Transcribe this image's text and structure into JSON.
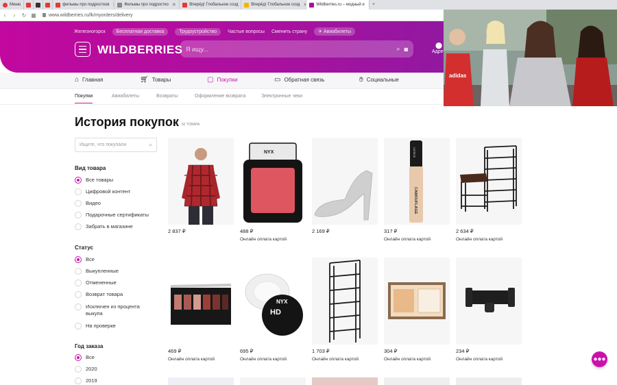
{
  "browser": {
    "menu_label": "Меню",
    "tabs": [
      {
        "label": "фильмы про подростков",
        "color": "#e53935"
      },
      {
        "label": "Фильмы про подростко",
        "color": "#888888"
      },
      {
        "label": "Вперёд! Глобальное созд",
        "color": "#e53935"
      },
      {
        "label": "Вперёд! Глобальное созд",
        "color": "#f4b400"
      },
      {
        "label": "Wildberries.ru – модный и",
        "color": "#a8119f",
        "active": true
      }
    ],
    "new_tab": "+",
    "url": "www.wildberries.ru/lk/myorders/delivery"
  },
  "header": {
    "links": [
      "Железногорск",
      "Бесплатная доставка",
      "Трудоустройство",
      "Частые вопросы",
      "Сменить страну",
      "Авиабилеты"
    ],
    "logo": "WILDBERRIES",
    "search_placeholder": "Я ищу...",
    "address_label": "Адрес"
  },
  "mainnav": [
    {
      "label": "Главная",
      "icon": "home-icon"
    },
    {
      "label": "Товары",
      "icon": "cart-icon"
    },
    {
      "label": "Покупки",
      "icon": "bag-icon",
      "active": true
    },
    {
      "label": "Обратная связь",
      "icon": "chat-icon"
    },
    {
      "label": "Социальные",
      "icon": "like-icon"
    }
  ],
  "subnav": [
    "Покупки",
    "Авиабилеты",
    "Возвраты",
    "Оформление возврата",
    "Электронные чеки"
  ],
  "page": {
    "title": "История покупок",
    "count": "92 товара"
  },
  "filters": {
    "search_placeholder": "Ищите, что покупали",
    "groups": [
      {
        "title": "Вид товара",
        "options": [
          "Все товары",
          "Цифровой контент",
          "Видео",
          "Подарочные сертификаты",
          "Забрать в магазине"
        ],
        "selected": 0
      },
      {
        "title": "Статус",
        "options": [
          "Все",
          "Выкупленные",
          "Отмененные",
          "Возврат товара",
          "Исключен из процента выкупа",
          "На проверке"
        ],
        "selected": 0
      },
      {
        "title": "Год заказа",
        "options": [
          "Все",
          "2020",
          "2019"
        ],
        "selected": 0
      }
    ]
  },
  "products": [
    {
      "price": "2 837 ₽",
      "pay": "",
      "kind": "shirt"
    },
    {
      "price": "488 ₽",
      "pay": "Онлайн оплата картой",
      "kind": "blush"
    },
    {
      "price": "2 169 ₽",
      "pay": "",
      "kind": "shoe"
    },
    {
      "price": "317 ₽",
      "pay": "Онлайн оплата картой",
      "kind": "concealer"
    },
    {
      "price": "2 634 ₽",
      "pay": "Онлайн оплата картой",
      "kind": "rack-bench"
    },
    {
      "price": "469 ₽",
      "pay": "Онлайн оплата картой",
      "kind": "palette"
    },
    {
      "price": "695 ₽",
      "pay": "Онлайн оплата картой",
      "kind": "powder"
    },
    {
      "price": "1 703 ₽",
      "pay": "Онлайн оплата картой",
      "kind": "rack"
    },
    {
      "price": "304 ₽",
      "pay": "Онлайн оплата картой",
      "kind": "box"
    },
    {
      "price": "234 ₽",
      "pay": "Онлайн оплата картой",
      "kind": "holder"
    }
  ],
  "product_text": {
    "blush_brand": "NYX",
    "concealer_brand": "CATRICE",
    "concealer_name": "CAMOUFLAGE",
    "powder_brand": "NYX",
    "powder_name": "HD"
  },
  "video": {
    "shirt_text": "adidas"
  },
  "colors": {
    "brand": "#cb11ab",
    "header_start": "#c2089e",
    "header_end": "#7b1fa2"
  }
}
